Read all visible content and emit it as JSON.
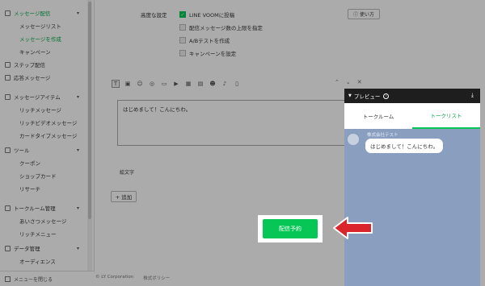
{
  "sidebar": {
    "items": [
      {
        "label": "メッセージ配信",
        "type": "section",
        "green": true
      },
      {
        "label": "メッセージリスト",
        "type": "sub"
      },
      {
        "label": "メッセージを作成",
        "type": "sub",
        "green": true
      },
      {
        "label": "キャンペーン",
        "type": "sub"
      },
      {
        "label": "ステップ配信",
        "type": "section"
      },
      {
        "label": "応答メッセージ",
        "type": "section"
      },
      {
        "label": "メッセージアイテム",
        "type": "section"
      },
      {
        "label": "リッチメッセージ",
        "type": "sub"
      },
      {
        "label": "リッチビデオメッセージ",
        "type": "sub"
      },
      {
        "label": "カードタイプメッセージ",
        "type": "sub"
      },
      {
        "label": "ツール",
        "type": "section"
      },
      {
        "label": "クーポン",
        "type": "sub"
      },
      {
        "label": "ショップカード",
        "type": "sub"
      },
      {
        "label": "リサーチ",
        "type": "sub"
      },
      {
        "label": "トークルーム管理",
        "type": "section"
      },
      {
        "label": "あいさつメッセージ",
        "type": "sub"
      },
      {
        "label": "リッチメニュー",
        "type": "sub"
      },
      {
        "label": "データ管理",
        "type": "section"
      },
      {
        "label": "オーディエンス",
        "type": "sub"
      }
    ],
    "collapse_label": "メニューを閉じる"
  },
  "advanced": {
    "label": "高度な設定",
    "options": [
      {
        "label": "LINE VOOMに投稿",
        "checked": true
      },
      {
        "label": "配信メッセージ数の上限を指定",
        "checked": false
      },
      {
        "label": "A/Bテストを作成",
        "checked": false
      },
      {
        "label": "キャンペーンを設定",
        "checked": false
      }
    ],
    "howto_label": "使い方"
  },
  "editor": {
    "text": "はじめまして！こんにちわ。",
    "aux_label": "絵文字",
    "add_label": "+ 追加"
  },
  "preview": {
    "title": "プレビュー",
    "tabs": [
      "トークルーム",
      "トークリスト"
    ],
    "active_tab": 1,
    "account_name": "株式会社テスト",
    "bubble_text": "はじめまして！こんにちわ。"
  },
  "schedule_button": "配信予約",
  "footer": {
    "copyright": "© LY Corporation",
    "privacy": "株式ポリシー"
  },
  "colors": {
    "line_green": "#06c755",
    "arrow_red": "#d9252b"
  }
}
